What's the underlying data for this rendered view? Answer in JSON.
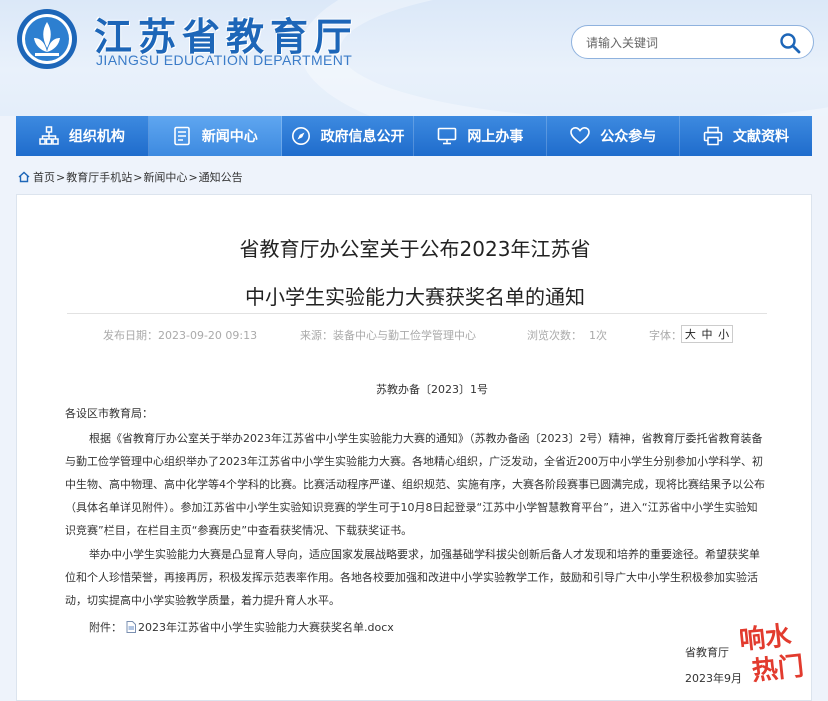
{
  "site": {
    "title": "江苏省教育厅",
    "subtitle": "JIANGSU EDUCATION DEPARTMENT"
  },
  "search": {
    "placeholder": "请输入关键词"
  },
  "nav": [
    {
      "label": "组织机构",
      "icon": "org-chart-icon"
    },
    {
      "label": "新闻中心",
      "icon": "news-doc-icon"
    },
    {
      "label": "政府信息公开",
      "icon": "compass-icon"
    },
    {
      "label": "网上办事",
      "icon": "monitor-icon"
    },
    {
      "label": "公众参与",
      "icon": "heart-icon"
    },
    {
      "label": "文献资料",
      "icon": "printer-icon"
    }
  ],
  "breadcrumb": [
    "首页",
    "教育厅手机站",
    "新闻中心",
    "通知公告"
  ],
  "article": {
    "title_line1": "省教育厅办公室关于公布2023年江苏省",
    "title_line2": "中小学生实验能力大赛获奖名单的通知",
    "date": "发布日期：2023-09-20 09:13",
    "source": "来源：装备中心与勤工俭学管理中心",
    "views": "浏览次数：  1次",
    "font_label": "字体：",
    "font_sizes": [
      "大",
      "中",
      "小"
    ],
    "doc_no": "苏教办备〔2023〕1号",
    "salutation": "各设区市教育局：",
    "para1": "根据《省教育厅办公室关于举办2023年江苏省中小学生实验能力大赛的通知》（苏教办备函〔2023〕2号）精神，省教育厅委托省教育装备与勤工俭学管理中心组织举办了2023年江苏省中小学生实验能力大赛。各地精心组织，广泛发动，全省近200万中小学生分别参加小学科学、初中生物、高中物理、高中化学等4个学科的比赛。比赛活动程序严谨、组织规范、实施有序，大赛各阶段赛事已圆满完成，现将比赛结果予以公布（具体名单详见附件）。参加江苏省中小学生实验知识竞赛的学生可于10月8日起登录“江苏中小学智慧教育平台”，进入“江苏省中小学生实验知识竞赛”栏目，在栏目主页“参赛历史”中查看获奖情况、下载获奖证书。",
    "para2": "举办中小学生实验能力大赛是凸显育人导向，适应国家发展战略要求，加强基础学科拔尖创新后备人才发现和培养的重要途径。希望获奖单位和个人珍惜荣誉，再接再厉，积极发挥示范表率作用。各地各校要加强和改进中小学实验教学工作，鼓励和引导广大中小学生积极参加实验活动，切实提高中小学实验教学质量，着力提升育人水平。",
    "attach_label": "附件：",
    "attach_file": "2023年江苏省中小学生实验能力大赛获奖名单.docx",
    "sign_org": "省教育厅",
    "sign_date": "2023年9月"
  },
  "watermark_text": "响水热门",
  "colors": {
    "nav_blue": "#1f6ccc",
    "brand_blue": "#1d66b8",
    "watermark_red": "#e23b2e"
  }
}
